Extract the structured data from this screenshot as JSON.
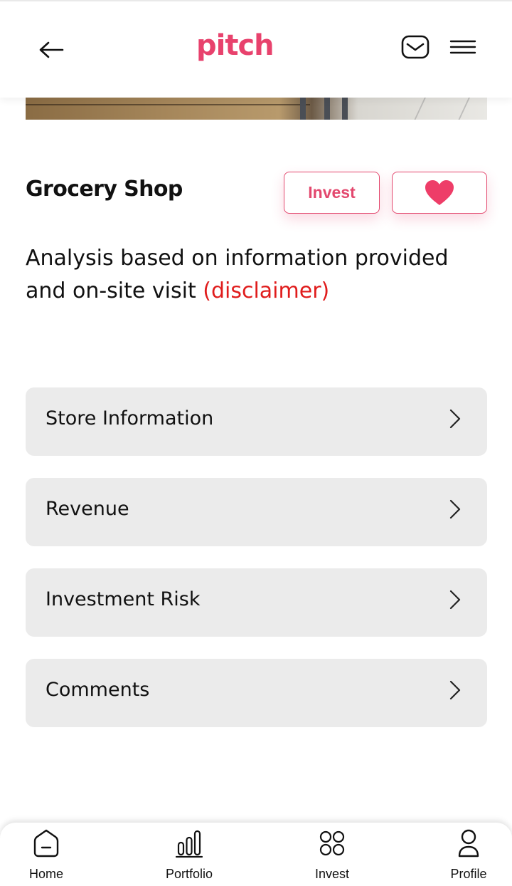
{
  "header": {
    "logo_text": "pitch",
    "back_icon": "arrow-left-icon",
    "mail_icon": "mail-icon",
    "menu_icon": "hamburger-menu-icon"
  },
  "colors": {
    "brand": "#e8426d",
    "disclaimer": "#e01c1c",
    "row_bg": "#ebebeb"
  },
  "business": {
    "title": "Grocery Shop",
    "invest_label": "Invest",
    "favorite_icon": "heart-icon"
  },
  "analysis": {
    "text": "Analysis based on information provided and on-site visit ",
    "disclaimer": "(disclaimer)"
  },
  "sections": [
    {
      "label": "Store Information"
    },
    {
      "label": "Revenue"
    },
    {
      "label": "Investment Risk"
    },
    {
      "label": "Comments"
    }
  ],
  "tabs": [
    {
      "label": "Home",
      "icon": "home-icon"
    },
    {
      "label": "Portfolio",
      "icon": "bar-chart-icon"
    },
    {
      "label": "Invest",
      "icon": "grid-circles-icon"
    },
    {
      "label": "Profile",
      "icon": "user-icon"
    }
  ]
}
